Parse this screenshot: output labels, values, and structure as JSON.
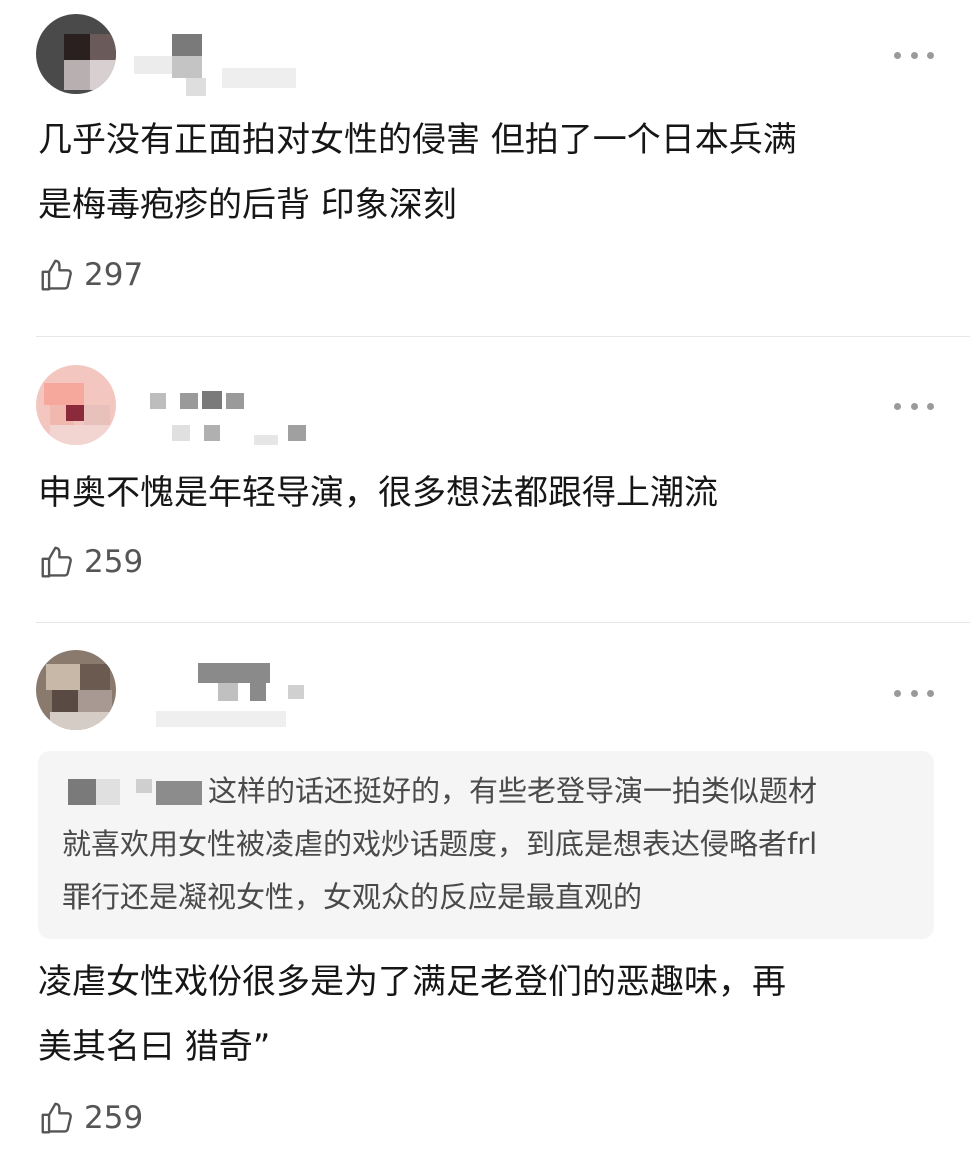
{
  "comments": [
    {
      "text": "几乎没有正面拍对女性的侵害 但拍了一个日本兵满\n是梅毒疱疹的后背 印象深刻",
      "likes": "297"
    },
    {
      "text": "申奥不愧是年轻导演，很多想法都跟得上潮流",
      "likes": "259"
    },
    {
      "quote": "这样的话还挺好的，有些老登导演一拍类似题材\n就喜欢用女性被凌虐的戏炒话题度，到底是想表达侵略者frl\n罪行还是凝视女性，女观众的反应是最直观的",
      "text": "凌虐女性戏份很多是为了满足老登们的恶趣味，再\n美其名曰 猎奇”",
      "likes": "259"
    }
  ],
  "icons": {
    "more": "more-dots-icon",
    "like": "thumbs-up-icon"
  },
  "colors": {
    "text": "#161616",
    "secondary": "#555555",
    "quote_bg": "#f5f5f5",
    "divider": "#e6e6e6"
  }
}
